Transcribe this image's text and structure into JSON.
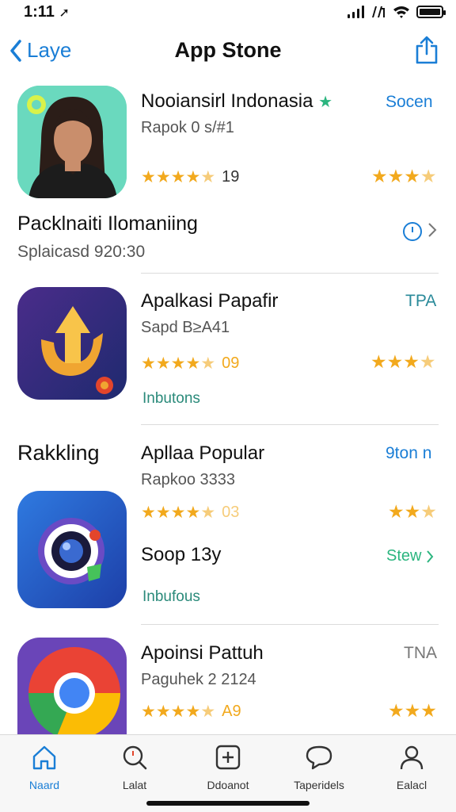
{
  "status_bar": {
    "time": "1:11",
    "time_arrow": "➚"
  },
  "nav": {
    "back_label": "Laye",
    "title": "App Stone",
    "share_icon": "share-icon"
  },
  "apps": [
    {
      "name": "Nooiansirl Indonasia",
      "sub": "Rapok 0 s/#1",
      "rating_count": "19",
      "action": "Socen",
      "name_badge": "★"
    },
    {
      "name": "Apalkasi Papafir",
      "sub": "Sapd  B≥A41",
      "rating_count": "09",
      "action": "TPA",
      "extra": "Inbutons"
    },
    {
      "name": "Apllaa Popular",
      "sub": "Rapkoo 3333",
      "rating_count": "03",
      "action": "9ton n",
      "second_name": "Soop 13y",
      "second_action": "Stew",
      "extra": "Inbufous"
    },
    {
      "name": "Apoinsi Pattuh",
      "sub": "Paguhek 2 2124",
      "rating_count": "A9",
      "action": "TNA"
    }
  ],
  "section_banner": {
    "title": "Packlnaiti Ilomaniing",
    "sub": "Splaicasd 920:30"
  },
  "section_ranking": {
    "title": "Rakkling"
  },
  "tabs": [
    {
      "label": "Naard",
      "icon": "home-icon"
    },
    {
      "label": "Lalat",
      "icon": "search-icon"
    },
    {
      "label": "Ddoanot",
      "icon": "add-icon"
    },
    {
      "label": "Taperidels",
      "icon": "chat-icon"
    },
    {
      "label": "Ealacl",
      "icon": "profile-icon"
    }
  ],
  "colors": {
    "accent": "#1a7ed6",
    "star": "#f2a91d",
    "teal": "#2a8a7a"
  }
}
